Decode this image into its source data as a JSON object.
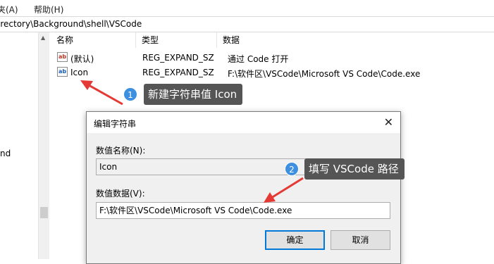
{
  "menubar": {
    "items": [
      {
        "label": "夹(A)"
      },
      {
        "label": "帮助(H)"
      }
    ]
  },
  "address": {
    "path": "irectory\\Background\\shell\\VSCode"
  },
  "tree": {
    "partial_label": "nd"
  },
  "list": {
    "columns": [
      "名称",
      "类型",
      "数据"
    ],
    "rows": [
      {
        "name": "(默认)",
        "type": "REG_EXPAND_SZ",
        "data": "通过 Code 打开",
        "icon": "reg-string-icon"
      },
      {
        "name": "Icon",
        "type": "REG_EXPAND_SZ",
        "data": "F:\\软件区\\VSCode\\Microsoft VS Code\\Code.exe",
        "icon": "reg-string-icon"
      }
    ]
  },
  "annotations": [
    {
      "number": "1",
      "text": "新建字符串值 Icon"
    },
    {
      "number": "2",
      "text": "填写 VSCode 路径"
    }
  ],
  "dialog": {
    "title": "编辑字符串",
    "close_glyph": "✕",
    "name_label": "数值名称(N):",
    "name_value": "Icon",
    "data_label": "数值数据(V):",
    "data_value": "F:\\软件区\\VSCode\\Microsoft VS Code\\Code.exe",
    "ok_label": "确定",
    "cancel_label": "取消"
  },
  "colors": {
    "callout_bg": "#555555",
    "badge_bg": "#3d8fe0",
    "arrow": "#e53935",
    "default_button_border": "#0078d7"
  }
}
